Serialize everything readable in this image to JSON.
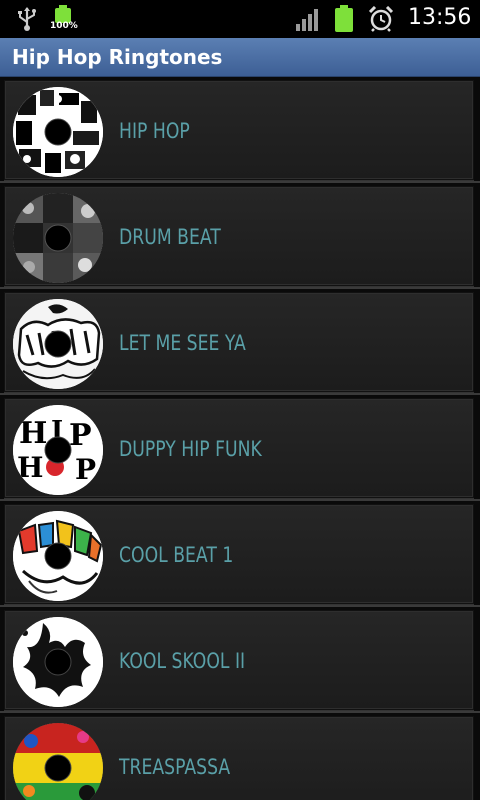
{
  "status_bar": {
    "battery_percent": "100%",
    "time": "13:56",
    "icons": [
      "usb-icon",
      "battery-icon",
      "signal-icon",
      "alarm-icon"
    ]
  },
  "title_bar": {
    "title": "Hip Hop Ringtones",
    "color": "#4a6fa5"
  },
  "ringtones": [
    {
      "label": "HIP HOP",
      "art": "collage-icon"
    },
    {
      "label": "DRUM BEAT",
      "art": "crowd-icon"
    },
    {
      "label": "LET ME SEE YA",
      "art": "graffiti-icon"
    },
    {
      "label": "DUPPY HIP FUNK",
      "art": "hip-hop-letters-icon"
    },
    {
      "label": "COOL BEAT 1",
      "art": "color-graffiti-icon"
    },
    {
      "label": "KOOL SKOOL II",
      "art": "splash-icon"
    },
    {
      "label": "TREASPASSA",
      "art": "rasta-icon"
    }
  ],
  "label_color": "#5aa0a8"
}
